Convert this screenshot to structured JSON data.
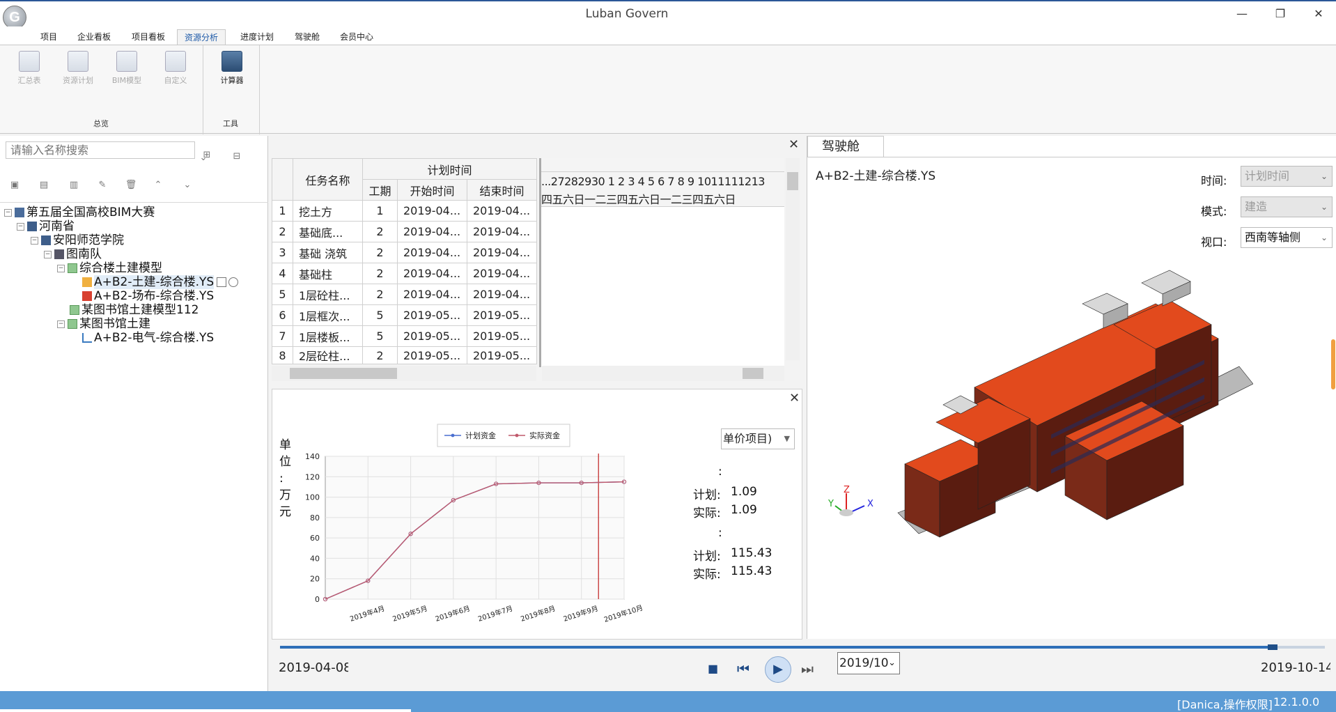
{
  "window": {
    "title": "Luban Govern",
    "logo_letter": "G",
    "min_glyph": "—",
    "max_glyph": "❐",
    "close_glyph": "✕"
  },
  "menu": [
    "项目",
    "企业看板",
    "项目看板",
    "资源分析",
    "进度计划",
    "驾驶舱",
    "会员中心"
  ],
  "ribbon": {
    "buttons": [
      {
        "label": "汇总表",
        "enabled": false
      },
      {
        "label": "资源计划",
        "enabled": false
      },
      {
        "label": "BIM模型",
        "enabled": false
      },
      {
        "label": "自定义",
        "enabled": false
      },
      {
        "label": "计算器",
        "enabled": true
      }
    ],
    "groups": [
      "总览",
      "工具"
    ]
  },
  "left": {
    "search_placeholder": "请输入名称搜索",
    "tree": [
      {
        "label": "第五届全国高校BIM大赛",
        "level": 0
      },
      {
        "label": "河南省",
        "level": 1
      },
      {
        "label": "安阳师范学院",
        "level": 2
      },
      {
        "label": "图南队",
        "level": 3
      },
      {
        "label": "综合楼土建模型",
        "level": 4
      },
      {
        "label": "A+B2-土建-综合楼.YS",
        "level": 5,
        "selected": true
      },
      {
        "label": "A+B2-场布-综合楼.YS",
        "level": 5
      },
      {
        "label": "某图书馆土建模型112",
        "level": 4
      },
      {
        "label": "某图书馆土建",
        "level": 4
      },
      {
        "label": "A+B2-电气-综合楼.YS",
        "level": 5
      }
    ]
  },
  "tasks": {
    "headers": {
      "name": "任务名称",
      "plan": "计划时间",
      "duration": "工期",
      "start": "开始时间",
      "end": "结束时间"
    },
    "rows": [
      {
        "no": "1",
        "name": "挖土方",
        "dur": "1",
        "start": "2019-04...",
        "end": "2019-04..."
      },
      {
        "no": "2",
        "name": "基础底...",
        "dur": "2",
        "start": "2019-04...",
        "end": "2019-04..."
      },
      {
        "no": "3",
        "name": "基础 浇筑",
        "dur": "2",
        "start": "2019-04...",
        "end": "2019-04..."
      },
      {
        "no": "4",
        "name": "基础柱",
        "dur": "2",
        "start": "2019-04...",
        "end": "2019-04..."
      },
      {
        "no": "5",
        "name": "1层砼柱...",
        "dur": "2",
        "start": "2019-04...",
        "end": "2019-04..."
      },
      {
        "no": "6",
        "name": "1层框次...",
        "dur": "5",
        "start": "2019-05...",
        "end": "2019-05..."
      },
      {
        "no": "7",
        "name": "1层楼板...",
        "dur": "5",
        "start": "2019-05...",
        "end": "2019-05..."
      },
      {
        "no": "8",
        "name": "2层砼柱...",
        "dur": "2",
        "start": "2019-05...",
        "end": "2019-05..."
      }
    ],
    "gantt_days": "...27282930 1  2  3  4  5  6  7  8  9 1011111213",
    "gantt_weekdays": "四五六日一二三四五六日一二三四五六日"
  },
  "chart": {
    "legend": [
      "计划资金",
      "实际资金"
    ],
    "ylabel_chars": [
      "单",
      "位",
      ":",
      "万",
      "元"
    ],
    "dropdown_label": "单价项目)",
    "colon_a": ":",
    "colon_b": ":",
    "plan_label_1": "计划:",
    "plan_value_1": "1.09",
    "actual_label_1": "实际:",
    "actual_value_1": "1.09",
    "plan_label_2": "计划:",
    "plan_value_2": "115.43",
    "actual_label_2": "实际:",
    "actual_value_2": "115.43"
  },
  "chart_data": {
    "type": "line",
    "categories": [
      "2019年4月",
      "2019年5月",
      "2019年6月",
      "2019年7月",
      "2019年8月",
      "2019年9月",
      "2019年10月"
    ],
    "x_start": "2019-04-08",
    "ylim": [
      0,
      140
    ],
    "yticks": [
      0,
      20,
      40,
      60,
      80,
      100,
      120,
      140
    ],
    "grid": true,
    "legend_position": "top",
    "series": [
      {
        "name": "计划资金",
        "color": "#4a6fd0",
        "values": [
          0,
          18,
          64,
          97,
          113,
          114,
          114,
          115
        ]
      },
      {
        "name": "实际资金",
        "color": "#c05a6c",
        "values": [
          0,
          18,
          64,
          97,
          113,
          114,
          114,
          115
        ]
      }
    ],
    "x_index": [
      "2019-04-08",
      "2019年4月",
      "2019年5月",
      "2019年6月",
      "2019年7月",
      "2019年8月",
      "2019年9月",
      "2019年10月"
    ],
    "marker_index": 6.4
  },
  "cockpit": {
    "tab": "驾驶舱",
    "model_name": "A+B2-土建-综合楼.YS",
    "time_label": "时间:",
    "time_value": "计划时间",
    "mode_label": "模式:",
    "mode_value": "建造",
    "view_label": "视口:",
    "view_value": "西南等轴侧",
    "axis_x": "X",
    "axis_y": "Y",
    "axis_z": "Z"
  },
  "timeline": {
    "start": "2019-04-08",
    "end": "2019-10-14",
    "current": "2019/10",
    "progress": 0.95
  },
  "status": {
    "user": "[Danica,操作权限]",
    "version": "12.1.0.0"
  }
}
